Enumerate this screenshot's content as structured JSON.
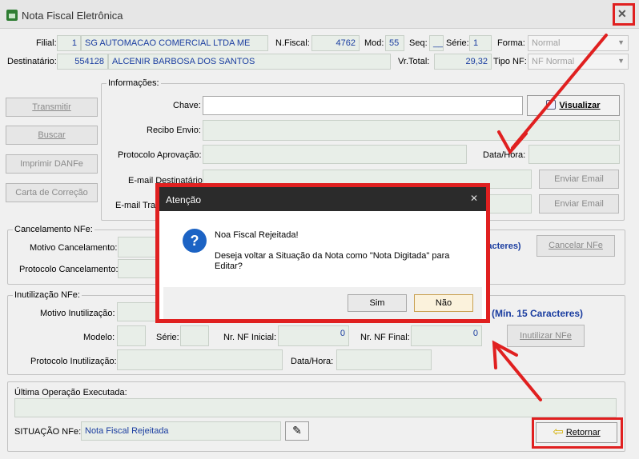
{
  "window": {
    "title": "Nota Fiscal Eletrônica",
    "close": "✕"
  },
  "header": {
    "filial_label": "Filial:",
    "filial_code": "1",
    "filial_name": "SG AUTOMACAO COMERCIAL LTDA ME",
    "nfiscal_label": "N.Fiscal:",
    "nfiscal": "4762",
    "mod_label": "Mod:",
    "mod": "55",
    "seq_label": "Seq:",
    "seq": "__",
    "serie_label": "Série:",
    "serie": "1",
    "forma_label": "Forma:",
    "forma": "Normal",
    "dest_label": "Destinatário:",
    "dest_code": "554128",
    "dest_name": "ALCENIR BARBOSA DOS SANTOS",
    "vrtotal_label": "Vr.Total:",
    "vrtotal": "29,32",
    "tiponf_label": "Tipo NF:",
    "tiponf": "NF Normal"
  },
  "actions": {
    "transmitir": "Transmitir",
    "buscar": "Buscar",
    "imprimir": "Imprimir DANFe",
    "carta": "Carta de Correção"
  },
  "info": {
    "title": "Informações:",
    "chave_label": "Chave:",
    "visualizar": "Visualizar",
    "recibo_label": "Recibo Envio:",
    "protocolo_label": "Protocolo Aprovação:",
    "datahora_label": "Data/Hora:",
    "email_dest_label": "E-mail Destinatário:",
    "email_trans_label": "E-mail Tra",
    "enviar1": "Enviar Email",
    "enviar2": "Enviar Email"
  },
  "cancel": {
    "title": "Cancelamento NFe:",
    "motivo_label": "Motivo Cancelamento:",
    "protocolo_label": "Protocolo Cancelamento:",
    "hint": "aracteres)",
    "button": "Cancelar NFe"
  },
  "inut": {
    "title": "Inutilização NFe:",
    "motivo_label": "Motivo Inutilização:",
    "hint": "(Mín. 15 Caracteres)",
    "modelo_label": "Modelo:",
    "serie_label": "Série:",
    "inicial_label": "Nr. NF Inicial:",
    "inicial": "0",
    "final_label": "Nr. NF Final:",
    "final": "0",
    "button": "Inutilizar NFe",
    "protocolo_label": "Protocolo Inutilização:",
    "datahora_label": "Data/Hora:"
  },
  "last_op": {
    "title": "Última Operação Executada:"
  },
  "situacao": {
    "label": "SITUAÇÃO NFe:",
    "value": "Nota Fiscal Rejeitada"
  },
  "retornar": "Retornar",
  "dialog": {
    "title": "Atenção",
    "close": "✕",
    "icon": "?",
    "line1": "Noa Fiscal Rejeitada!",
    "line2": "Deseja voltar a Situação da Nota como \"Nota Digitada\" para",
    "line3": "Editar?",
    "yes": "Sim",
    "no": "Não"
  },
  "colors": {
    "accent_red": "#e02020",
    "field_text": "#1a3da0",
    "dialog_titlebar": "#2b2b2b"
  }
}
